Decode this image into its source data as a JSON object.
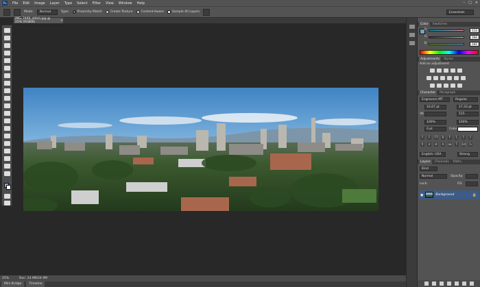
{
  "menubar": {
    "logo": "Ps",
    "items": [
      "File",
      "Edit",
      "Image",
      "Layer",
      "Type",
      "Select",
      "Filter",
      "View",
      "Window",
      "Help"
    ],
    "window_controls": [
      "–",
      "□",
      "×"
    ]
  },
  "options_bar": {
    "mode_label": "Mode:",
    "mode_value": "Normal",
    "type_label": "Type:",
    "type_options": [
      "Proximity Match",
      "Create Texture",
      "Content-Aware"
    ],
    "sample_all_layers": "Sample All Layers",
    "workspace": "Essentials"
  },
  "document": {
    "tab_title": "IMG_7440_stitch.jpg @ 25% (RGB/8)",
    "close": "×",
    "status_zoom": "25%",
    "status_doc": "Doc: 24.9M/24.9M"
  },
  "bottom_tabs": [
    "Mini Bridge",
    "Timeline"
  ],
  "color_panel": {
    "tabs": [
      "Color",
      "Swatches"
    ],
    "channels": [
      {
        "label": "R",
        "value": "113"
      },
      {
        "label": "G",
        "value": "164"
      },
      {
        "label": "B",
        "value": "191"
      }
    ],
    "foreground": "#71a4bf"
  },
  "adjustments_panel": {
    "tabs": [
      "Adjustments",
      "Styles"
    ],
    "heading": "Add an adjustment"
  },
  "character_panel": {
    "tabs": [
      "Character",
      "Paragraph"
    ],
    "font_family": "Engravers MT",
    "font_style": "Regular",
    "font_size": "10.67 pt",
    "leading": "17.33 pt",
    "tracking_label": "VA",
    "kerning": "",
    "tracking": "515",
    "vertical_scale": "100%",
    "horizontal_scale": "100%",
    "baseline_shift": "0 pt",
    "color_label": "Color:",
    "text_color": "#ffffff",
    "language": "English: USA",
    "antialias": "Strong",
    "style_buttons": [
      "T",
      "T",
      "TT",
      "Tr",
      "T'",
      "T,",
      "T",
      "T"
    ],
    "otype_buttons": [
      "fi",
      "σ",
      "st",
      "A",
      "aa",
      "T",
      "1st",
      "½"
    ]
  },
  "layers_panel": {
    "tabs": [
      "Layers",
      "Channels",
      "Paths"
    ],
    "filter_label": "Kind",
    "blend_mode": "Normal",
    "opacity_label": "Opacity:",
    "fill_label": "Fill:",
    "lock_label": "Lock:",
    "layers": [
      {
        "name": "Background",
        "locked": true
      }
    ]
  }
}
